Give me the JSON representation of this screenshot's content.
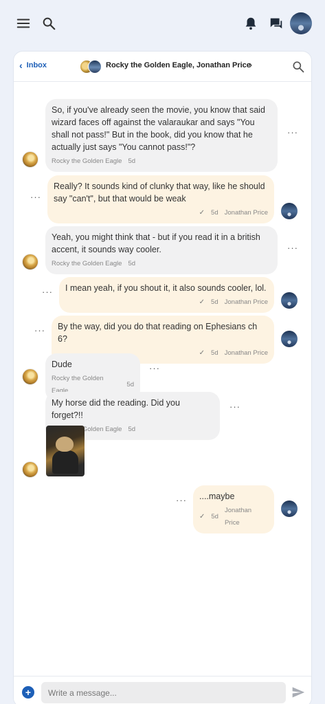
{
  "topbar": {
    "menu_icon": "menu-icon",
    "search_icon": "search-icon",
    "notifications_icon": "bell-icon",
    "messages_icon": "chat-icon",
    "accent": "#1d5fb7"
  },
  "chat": {
    "back_label": "Inbox",
    "participants": "Rocky the Golden Eagle, Jonathan Price"
  },
  "messages": [
    {
      "text": "So, if you've already seen the movie, you know that said wizard faces off against the valaraukar and says \"You shall not pass!\" But in the book, did you know that he actually just says \"You cannot pass!\"?",
      "sender": "Rocky the Golden Eagle",
      "time": "5d"
    },
    {
      "text": "Really? It sounds kind of clunky that way, like he should say \"can't\", but that would be weak",
      "sender": "Jonathan Price",
      "time": "5d"
    },
    {
      "text": "Yeah, you might think that - but if you read it in a british accent, it sounds way cooler.",
      "sender": "Rocky the Golden Eagle",
      "time": "5d"
    },
    {
      "text": "I mean yeah, if you shout it, it also sounds cooler, lol.",
      "sender": "Jonathan Price",
      "time": "5d"
    },
    {
      "text": "By the way, did you do that reading on Ephesians ch 6?",
      "sender": "Jonathan Price",
      "time": "5d"
    },
    {
      "text": "Dude",
      "sender": "Rocky the Golden Eagle",
      "time": "5d"
    },
    {
      "text": "My horse did the reading. Did you forget?!!",
      "sender": "Rocky the Golden Eagle",
      "time": "5d"
    },
    {
      "text": "....maybe",
      "sender": "Jonathan Price",
      "time": "5d"
    }
  ],
  "composer": {
    "placeholder": "Write a message..."
  }
}
